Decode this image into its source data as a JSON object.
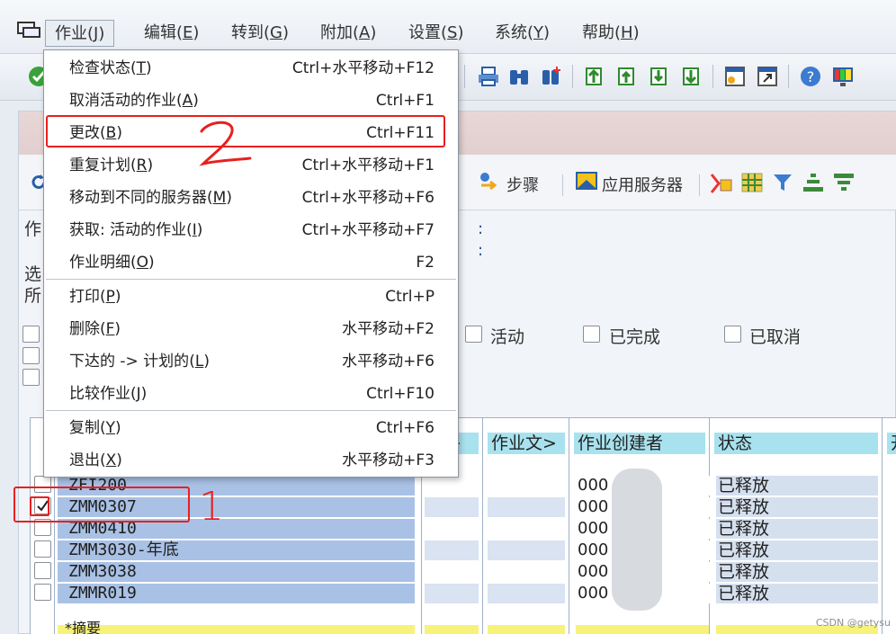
{
  "menubar": {
    "items": [
      {
        "text": "作业",
        "key": "J"
      },
      {
        "text": "编辑",
        "key": "E"
      },
      {
        "text": "转到",
        "key": "G"
      },
      {
        "text": "附加",
        "key": "A"
      },
      {
        "text": "设置",
        "key": "S"
      },
      {
        "text": "系统",
        "key": "Y"
      },
      {
        "text": "帮助",
        "key": "H"
      }
    ]
  },
  "app_toolbar": {
    "steps_label": "步骤",
    "app_server_label": "应用服务器"
  },
  "labels": {
    "job_name_fragment": "作",
    "select_fragment": "选",
    "all_fragment": "所",
    "active": "活动",
    "finished": "已完成",
    "cancelled": "已取消"
  },
  "table": {
    "headers": [
      "说>",
      "作业文>",
      "作业创建者",
      "状态",
      "开"
    ],
    "creator_prefix": "000",
    "rows": [
      {
        "job": "ZFI200",
        "status": "已释放",
        "checked": false
      },
      {
        "job": "ZMM0307",
        "status": "已释放",
        "checked": true
      },
      {
        "job": "ZMM0410",
        "status": "已释放",
        "checked": false
      },
      {
        "job": "ZMM3030-年底",
        "status": "已释放",
        "checked": false
      },
      {
        "job": "ZMM3038",
        "status": "已释放",
        "checked": false
      },
      {
        "job": "ZMMR019",
        "status": "已释放",
        "checked": false
      }
    ],
    "summary_label": "*摘要"
  },
  "dropdown": {
    "items": [
      {
        "label": "检查状态",
        "key": "T",
        "shortcut": "Ctrl+水平移动+F12"
      },
      {
        "label": "取消活动的作业",
        "key": "A",
        "shortcut": "Ctrl+F1"
      },
      {
        "label": "更改",
        "key": "B",
        "shortcut": "Ctrl+F11"
      },
      {
        "label": "重复计划",
        "key": "R",
        "shortcut": "Ctrl+水平移动+F1"
      },
      {
        "label": "移动到不同的服务器",
        "key": "M",
        "shortcut": "Ctrl+水平移动+F6"
      },
      {
        "label": "获取: 活动的作业",
        "key": "I",
        "shortcut": "Ctrl+水平移动+F7"
      },
      {
        "label": "作业明细",
        "key": "O",
        "shortcut": "F2"
      },
      {
        "label": "打印",
        "key": "P",
        "shortcut": "Ctrl+P"
      },
      {
        "label": "删除",
        "key": "F",
        "shortcut": "水平移动+F2"
      },
      {
        "label": "下达的 -> 计划的",
        "key": "L",
        "shortcut": "水平移动+F6"
      },
      {
        "label": "比较作业",
        "key": "J",
        "shortcut": "Ctrl+F10"
      },
      {
        "label": "复制",
        "key": "Y",
        "shortcut": "Ctrl+F6"
      },
      {
        "label": "退出",
        "key": "X",
        "shortcut": "水平移动+F3"
      }
    ]
  },
  "annotations": {
    "step1": "1",
    "step2": "2"
  },
  "watermark": "CSDN @getysu",
  "colors": {
    "highlight_red": "#e82020",
    "header_cyan": "#a8e2ee",
    "job_blue": "#a9c1e5"
  }
}
